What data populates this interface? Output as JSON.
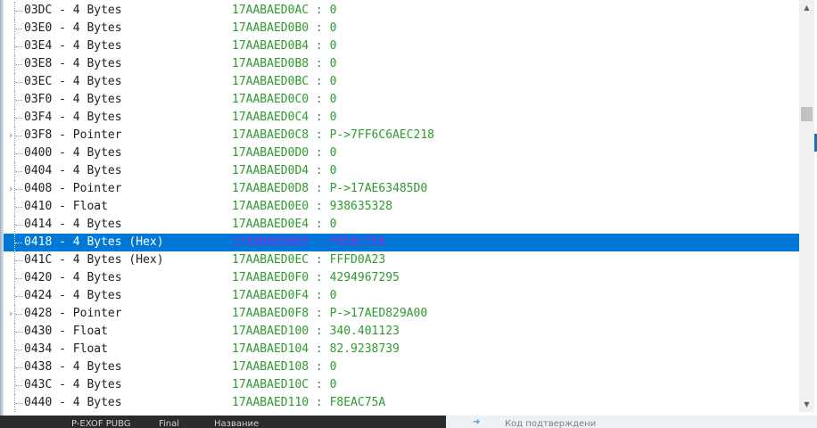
{
  "rows": [
    {
      "offset": "03DC",
      "type": "4 Bytes",
      "address": "17AABAED0AC",
      "value": "0",
      "expandable": false,
      "selected": false
    },
    {
      "offset": "03E0",
      "type": "4 Bytes",
      "address": "17AABAED0B0",
      "value": "0",
      "expandable": false,
      "selected": false
    },
    {
      "offset": "03E4",
      "type": "4 Bytes",
      "address": "17AABAED0B4",
      "value": "0",
      "expandable": false,
      "selected": false
    },
    {
      "offset": "03E8",
      "type": "4 Bytes",
      "address": "17AABAED0B8",
      "value": "0",
      "expandable": false,
      "selected": false
    },
    {
      "offset": "03EC",
      "type": "4 Bytes",
      "address": "17AABAED0BC",
      "value": "0",
      "expandable": false,
      "selected": false
    },
    {
      "offset": "03F0",
      "type": "4 Bytes",
      "address": "17AABAED0C0",
      "value": "0",
      "expandable": false,
      "selected": false
    },
    {
      "offset": "03F4",
      "type": "4 Bytes",
      "address": "17AABAED0C4",
      "value": "0",
      "expandable": false,
      "selected": false
    },
    {
      "offset": "03F8",
      "type": "Pointer",
      "address": "17AABAED0C8",
      "value": "P->7FF6C6AEC218",
      "expandable": true,
      "selected": false
    },
    {
      "offset": "0400",
      "type": "4 Bytes",
      "address": "17AABAED0D0",
      "value": "0",
      "expandable": false,
      "selected": false
    },
    {
      "offset": "0404",
      "type": "4 Bytes",
      "address": "17AABAED0D4",
      "value": "0",
      "expandable": false,
      "selected": false
    },
    {
      "offset": "0408",
      "type": "Pointer",
      "address": "17AABAED0D8",
      "value": "P->17AE63485D0",
      "expandable": true,
      "selected": false
    },
    {
      "offset": "0410",
      "type": "Float",
      "address": "17AABAED0E0",
      "value": "938635328",
      "expandable": false,
      "selected": false
    },
    {
      "offset": "0414",
      "type": "4 Bytes",
      "address": "17AABAED0E4",
      "value": "0",
      "expandable": false,
      "selected": false
    },
    {
      "offset": "0418",
      "type": "4 Bytes (Hex)",
      "address": "17AABAED0E8",
      "value": "F8EAC75A",
      "expandable": false,
      "selected": true
    },
    {
      "offset": "041C",
      "type": "4 Bytes (Hex)",
      "address": "17AABAED0EC",
      "value": "FFFD0A23",
      "expandable": false,
      "selected": false
    },
    {
      "offset": "0420",
      "type": "4 Bytes",
      "address": "17AABAED0F0",
      "value": "4294967295",
      "expandable": false,
      "selected": false
    },
    {
      "offset": "0424",
      "type": "4 Bytes",
      "address": "17AABAED0F4",
      "value": "0",
      "expandable": false,
      "selected": false
    },
    {
      "offset": "0428",
      "type": "Pointer",
      "address": "17AABAED0F8",
      "value": "P->17AED829A00",
      "expandable": true,
      "selected": false
    },
    {
      "offset": "0430",
      "type": "Float",
      "address": "17AABAED100",
      "value": "340.401123",
      "expandable": false,
      "selected": false
    },
    {
      "offset": "0434",
      "type": "Float",
      "address": "17AABAED104",
      "value": "82.9238739",
      "expandable": false,
      "selected": false
    },
    {
      "offset": "0438",
      "type": "4 Bytes",
      "address": "17AABAED108",
      "value": "0",
      "expandable": false,
      "selected": false
    },
    {
      "offset": "043C",
      "type": "4 Bytes",
      "address": "17AABAED10C",
      "value": "0",
      "expandable": false,
      "selected": false
    },
    {
      "offset": "0440",
      "type": "4 Bytes",
      "address": "17AABAED110",
      "value": "F8EAC75A",
      "expandable": false,
      "selected": false
    }
  ],
  "row_separator": " - ",
  "value_separator": " : ",
  "taskbar": {
    "items": [
      "P-EXOF PUBG",
      "Final",
      "Название"
    ],
    "hint": "Код подтверждени"
  },
  "icons": {
    "expander": "chevron-right-icon",
    "scroll_up": "scroll-up-arrow-icon",
    "scroll_down": "scroll-down-arrow-icon"
  },
  "colors": {
    "selection": "#0078d7",
    "address_text": "#2e9b2e",
    "selected_address_text": "#8a2be2"
  }
}
